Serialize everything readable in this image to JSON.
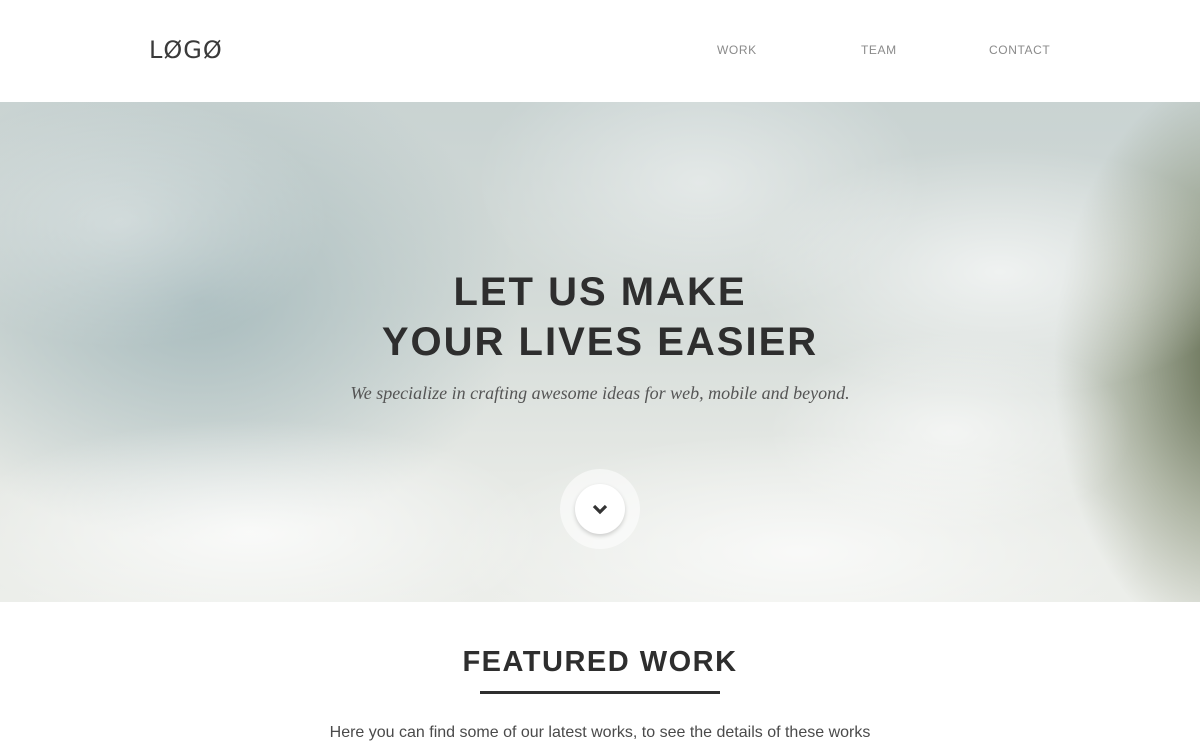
{
  "header": {
    "logo": "LØGØ",
    "nav": [
      {
        "label": "WORK"
      },
      {
        "label": "TEAM"
      },
      {
        "label": "CONTACT"
      }
    ]
  },
  "hero": {
    "title_line1": "LET US MAKE",
    "title_line2": "YOUR LIVES EASIER",
    "subtitle": "We specialize in crafting awesome ideas for web, mobile and beyond.",
    "scroll_icon": "chevron-down-icon"
  },
  "featured": {
    "title": "FEATURED WORK",
    "description": "Here you can find some of our latest works, to see the details of these works"
  },
  "colors": {
    "text_dark": "#2e2e2e",
    "nav_text": "#8a8a8a",
    "background": "#ffffff"
  }
}
